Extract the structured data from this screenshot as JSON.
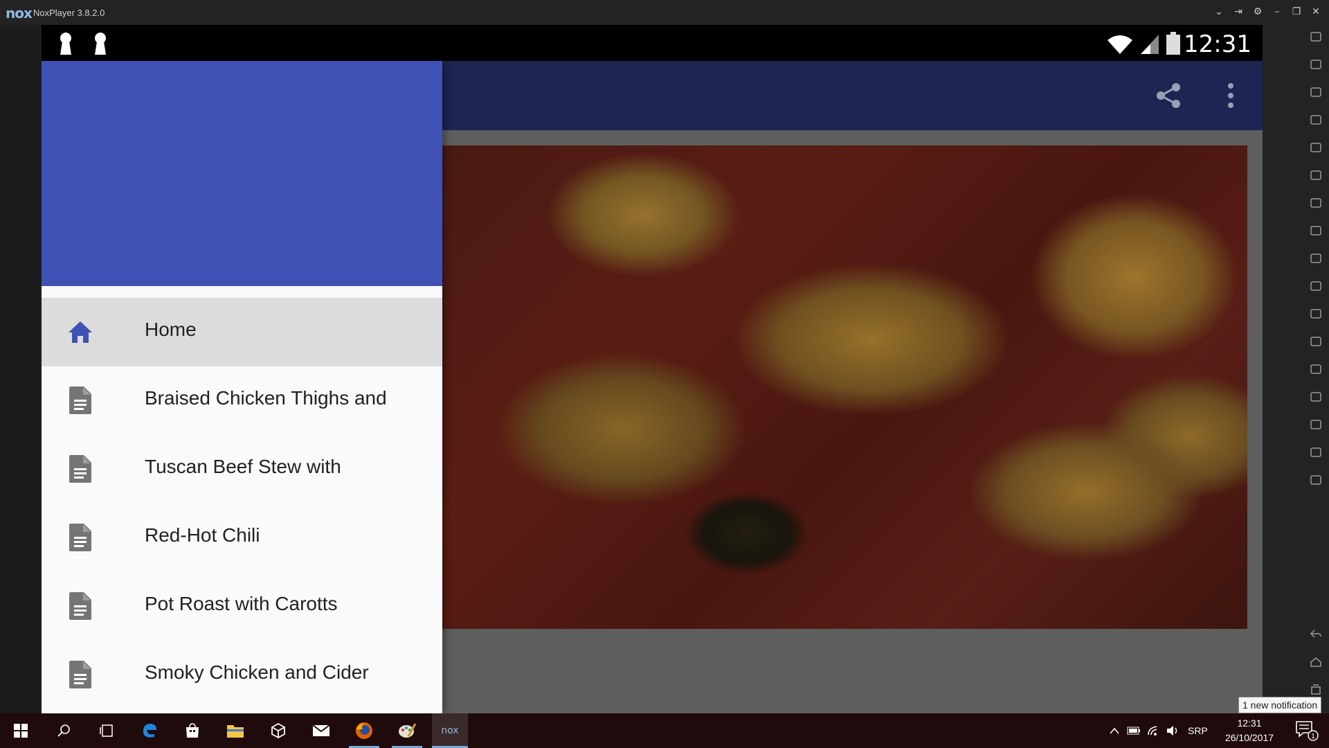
{
  "window": {
    "logo": "nox",
    "title": "NoxPlayer 3.8.2.0",
    "controls": [
      "chevron-down-icon",
      "pin-icon",
      "settings-icon",
      "minimize-icon",
      "restore-icon",
      "close-icon"
    ]
  },
  "status_bar": {
    "time": "12:31",
    "left_icons": [
      "keyhole-icon",
      "keyhole-icon"
    ],
    "right_icons": [
      "wifi-icon",
      "signal-icon",
      "battery-icon"
    ]
  },
  "app_bar": {
    "actions": [
      "share-icon",
      "more-vert-icon"
    ]
  },
  "drawer": {
    "header_color": "#4051b5",
    "items": [
      {
        "label": "Home",
        "icon": "home-icon",
        "active": true
      },
      {
        "label": "Braised Chicken Thighs and",
        "icon": "document-icon",
        "active": false
      },
      {
        "label": "Tuscan Beef Stew with",
        "icon": "document-icon",
        "active": false
      },
      {
        "label": "Red-Hot Chili",
        "icon": "document-icon",
        "active": false
      },
      {
        "label": "Pot Roast with Carotts",
        "icon": "document-icon",
        "active": false
      },
      {
        "label": "Smoky Chicken and Cider",
        "icon": "document-icon",
        "active": false
      }
    ]
  },
  "nox_toolbar": {
    "buttons": [
      "shake-icon",
      "keyboard-icon",
      "scissors-icon",
      "location-icon",
      "screen-icon",
      "fullscreen-icon",
      "volume-up-icon",
      "volume-down-icon",
      "install-apk-icon",
      "loading-icon",
      "multi-instance-icon",
      "record-icon",
      "printer-icon",
      "shared-folder-icon",
      "sync-icon",
      "menu-icon",
      "add-icon"
    ],
    "nav_buttons": [
      "back-icon",
      "home-icon",
      "recent-apps-icon"
    ]
  },
  "taskbar": {
    "apps": [
      "windows-start-icon",
      "search-icon",
      "task-view-icon",
      "edge-icon",
      "store-icon",
      "file-explorer-icon",
      "unity-icon",
      "mail-icon",
      "firefox-icon",
      "paint-icon",
      "nox-icon"
    ],
    "tray_icons": [
      "chevron-up-icon",
      "battery-icon",
      "network-icon",
      "volume-icon"
    ],
    "language": "SRP",
    "time": "12:31",
    "date": "26/10/2017",
    "notification_count": "1",
    "notification_tooltip": "1 new notification"
  },
  "colors": {
    "app_bar": "#1e2553",
    "drawer_active": "#dcdcdc",
    "icon_accent": "#4051b5",
    "taskbar": "#1f0b0b"
  }
}
